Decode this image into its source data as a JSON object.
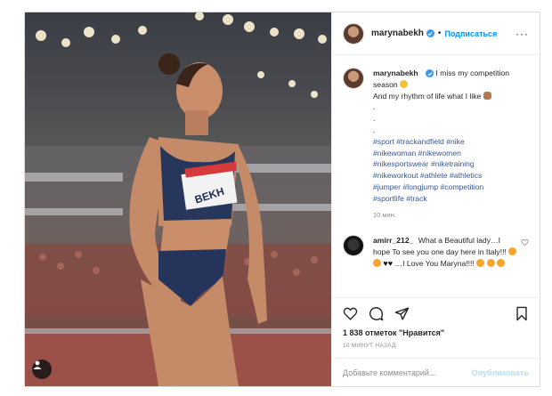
{
  "post": {
    "username": "marynabekh",
    "follow_label": "Подписаться",
    "more_label": "···",
    "caption_lines": [
      "I miss my competition season",
      "And my rhythm of life what I like"
    ],
    "caption_dots": [
      ".",
      ".",
      "."
    ],
    "hashtags": [
      "#sport",
      "#trackandfield",
      "#nike",
      "#nikewoman",
      "#nikewomen",
      "#nikesportswear",
      "#niketraining",
      "#nikeworkout",
      "#athlete",
      "#athletics",
      "#jumper",
      "#longjump",
      "#competition",
      "#sportlife",
      "#track"
    ],
    "caption_time": "10 мин.",
    "comment": {
      "username": "amirr_212_",
      "text_1": "What a Beautiful lady…I hope To see you one day here in Italy!!!",
      "text_2": "…I Love You Maryna!!!!"
    },
    "likes": "1 838 отметок \"Нравится\"",
    "posted_time": "10 МИНУТ НАЗАД",
    "comment_placeholder": "Добавьте комментарий...",
    "publish_label": "Опубликовать",
    "bib_text": "BEKH"
  },
  "icons": {
    "like": "heart-icon",
    "comment": "comment-icon",
    "share": "share-icon",
    "save": "bookmark-icon",
    "tag": "user-tag-icon",
    "verified": "verified-badge-icon"
  },
  "colors": {
    "accent": "#0095f6",
    "hashtag": "#385898",
    "verified": "#3897f0",
    "muted": "#8e8e8e"
  }
}
